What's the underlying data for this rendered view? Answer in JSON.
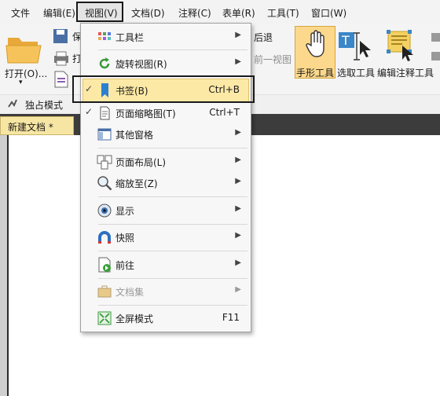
{
  "menubar": {
    "file": "文件",
    "edit": "编辑(E)",
    "view": "视图(V)",
    "document": "文档(D)",
    "comment": "注释(C)",
    "form": "表单(R)",
    "tools": "工具(T)",
    "window": "窗口(W)"
  },
  "toolbar": {
    "open": "打开(O)...",
    "back": "后退",
    "prev_view": "前一视图",
    "hand_tool": "手形工具",
    "select_tool": "选取工具",
    "edit_annotation_tool": "编辑注释工具",
    "partial_left": "保",
    "partial_left2": "打"
  },
  "mode_row": {
    "exclusive_mode": "独占模式"
  },
  "tabs": {
    "new_document": "新建文档 *"
  },
  "view_menu": {
    "items": [
      {
        "label": "工具栏",
        "shortcut": "",
        "submenu": true,
        "icon": "toolbar-grid-icon"
      },
      {
        "label": "旋转视图(R)",
        "shortcut": "",
        "submenu": true,
        "icon": "rotate-icon"
      },
      {
        "label": "书签(B)",
        "shortcut": "Ctrl+B",
        "submenu": false,
        "checked": true,
        "icon": "bookmark-icon"
      },
      {
        "label": "页面缩略图(T)",
        "shortcut": "Ctrl+T",
        "submenu": false,
        "checked": true,
        "icon": "page-thumbnail-icon"
      },
      {
        "label": "其他窗格",
        "shortcut": "",
        "submenu": true,
        "icon": "pane-icon"
      },
      {
        "label": "页面布局(L)",
        "shortcut": "",
        "submenu": true,
        "icon": "page-layout-icon"
      },
      {
        "label": "缩放至(Z)",
        "shortcut": "",
        "submenu": true,
        "icon": "zoom-icon"
      },
      {
        "label": "显示",
        "shortcut": "",
        "submenu": true,
        "icon": "eye-icon"
      },
      {
        "label": "快照",
        "shortcut": "",
        "submenu": true,
        "icon": "magnet-icon"
      },
      {
        "label": "前往",
        "shortcut": "",
        "submenu": true,
        "icon": "goto-icon"
      },
      {
        "label": "文档集",
        "shortcut": "",
        "submenu": true,
        "disabled": true,
        "icon": "briefcase-icon"
      },
      {
        "label": "全屏模式",
        "shortcut": "F11",
        "submenu": false,
        "icon": "fullscreen-icon"
      }
    ],
    "arrow": "▶",
    "check": "✓"
  },
  "colors": {
    "highlight": "#fde9a6",
    "hand_button": "#fbd88b",
    "tab_bar": "#3c3c3c"
  }
}
